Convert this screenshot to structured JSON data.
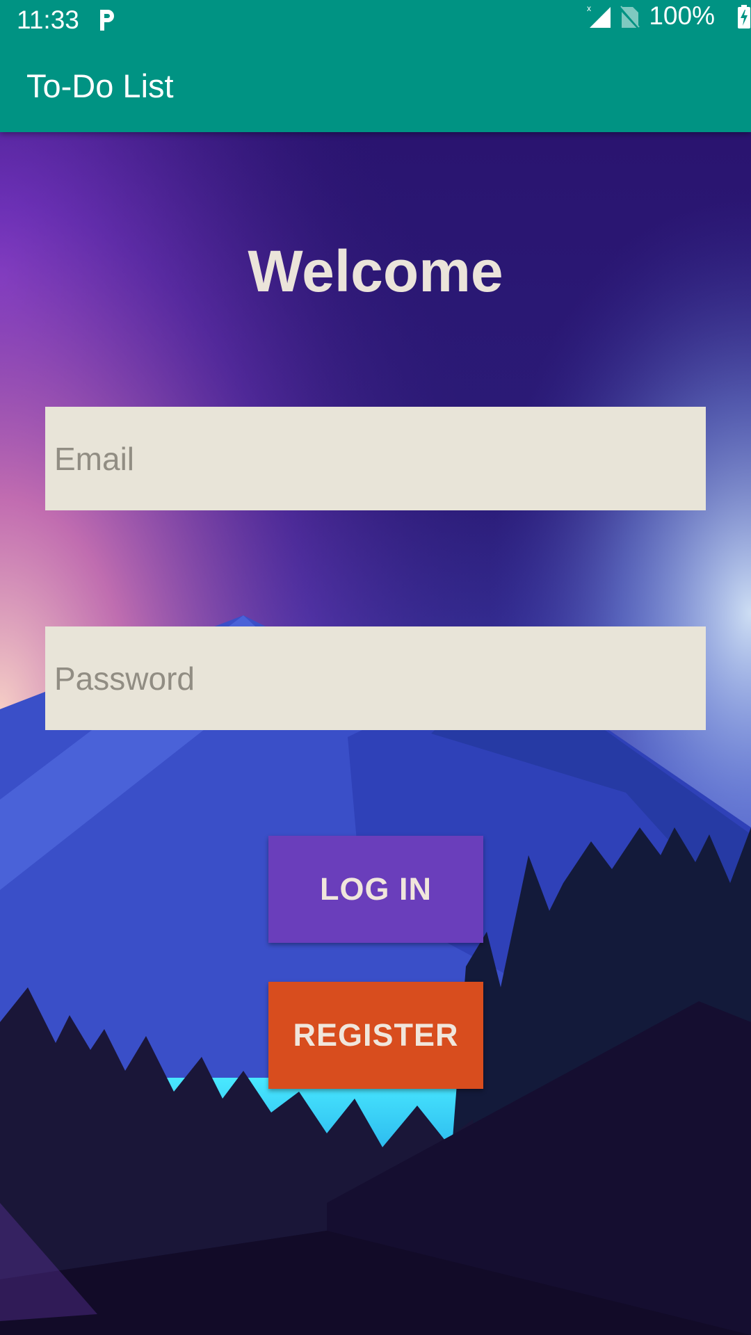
{
  "status_bar": {
    "time": "11:33",
    "notification_icon": "parking-p-icon",
    "signal_icon": "cell-signal-icon",
    "sim_icon": "no-sim-icon",
    "battery_percent": "100%",
    "battery_icon": "battery-charging-icon"
  },
  "app_bar": {
    "title": "To-Do List",
    "color": "#009383"
  },
  "main": {
    "heading": "Welcome",
    "email_placeholder": "Email",
    "password_placeholder": "Password",
    "login_label": "LOG IN",
    "register_label": "REGISTER"
  },
  "colors": {
    "login_button": "#6a3ebb",
    "register_button": "#d84d1e",
    "field_background": "#e8e4d8",
    "heading_text": "#ebe4da"
  }
}
